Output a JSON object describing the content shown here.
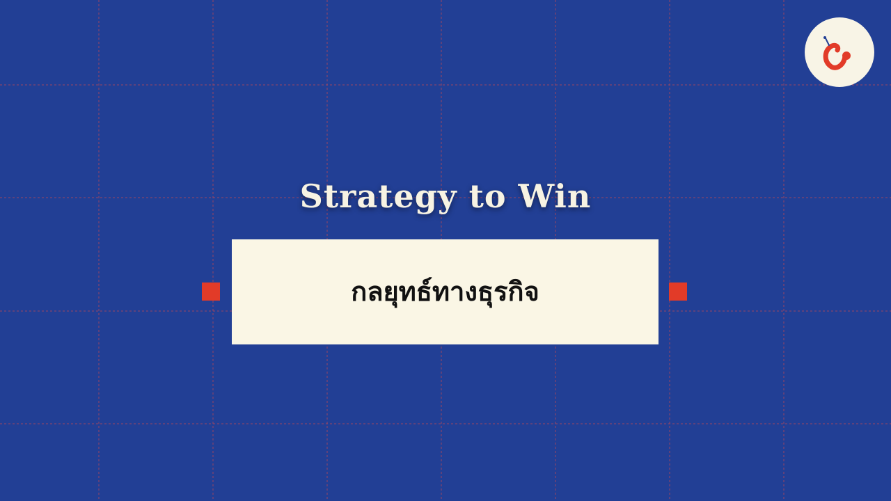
{
  "slide": {
    "title": "Strategy to Win",
    "subtitle": "กลยุทธ์ทางธุรกิจ"
  },
  "logo": {
    "icon": "c-logo-icon"
  },
  "colors": {
    "background": "#223f95",
    "panel": "#faf6e5",
    "accent": "#e23b28",
    "title_text": "#f7f3e3",
    "panel_text": "#111111",
    "grid_line": "#a6465e"
  }
}
